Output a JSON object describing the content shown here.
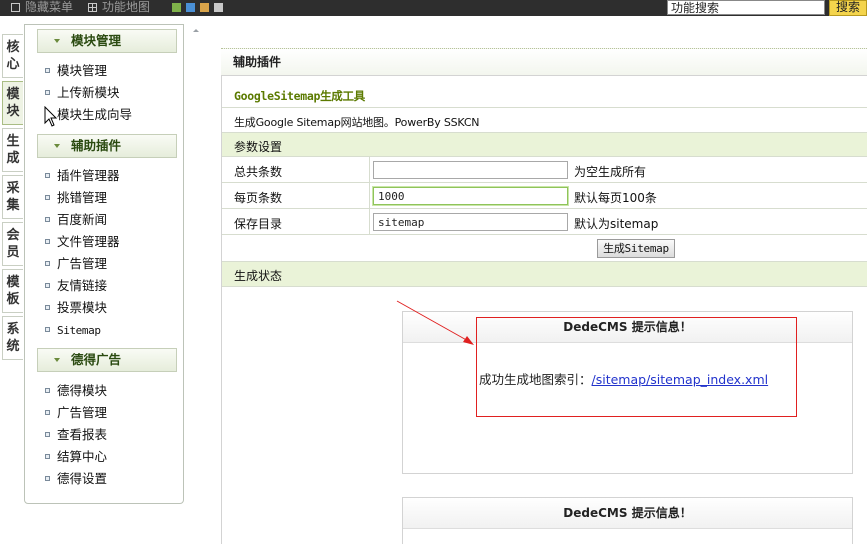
{
  "topbar": {
    "hide_menu": "隐藏菜单",
    "function_map": "功能地图",
    "theme_colors": [
      "#7fb24a",
      "#4a90d6",
      "#d9a44a",
      "#c8c8c8"
    ],
    "search_value": "功能搜索",
    "search_button": "搜索"
  },
  "vtabs": [
    {
      "label": "核心"
    },
    {
      "label": "模块"
    },
    {
      "label": "生成"
    },
    {
      "label": "采集"
    },
    {
      "label": "会员"
    },
    {
      "label": "模板"
    },
    {
      "label": "系统"
    }
  ],
  "menu": {
    "groups": [
      {
        "title": "模块管理",
        "items": [
          "模块管理",
          "上传新模块",
          "模块生成向导"
        ]
      },
      {
        "title": "辅助插件",
        "items": [
          "插件管理器",
          "挑错管理",
          "百度新闻",
          "文件管理器",
          "广告管理",
          "友情链接",
          "投票模块",
          "Sitemap"
        ]
      },
      {
        "title": "德得广告",
        "items": [
          "德得模块",
          "广告管理",
          "查看报表",
          "结算中心",
          "德得设置"
        ]
      }
    ]
  },
  "content": {
    "page_title": "辅助插件",
    "tool_title": "GoogleSitemap生成工具",
    "description": "生成Google Sitemap网站地图。PowerBy SSKCN",
    "params_section": "参数设置",
    "fields": [
      {
        "label": "总共条数",
        "value": "",
        "hint": "为空生成所有"
      },
      {
        "label": "每页条数",
        "value": "1000",
        "hint": "默认每页100条"
      },
      {
        "label": "保存目录",
        "value": "sitemap",
        "hint": "默认为sitemap"
      }
    ],
    "generate_button": "生成Sitemap",
    "status_section": "生成状态"
  },
  "messages": [
    {
      "title": "DedeCMS 提示信息！",
      "text": "成功生成地图索引：",
      "link": "/sitemap/sitemap_index.xml"
    },
    {
      "title": "DedeCMS 提示信息！"
    }
  ],
  "annotation_color": "#e02020"
}
